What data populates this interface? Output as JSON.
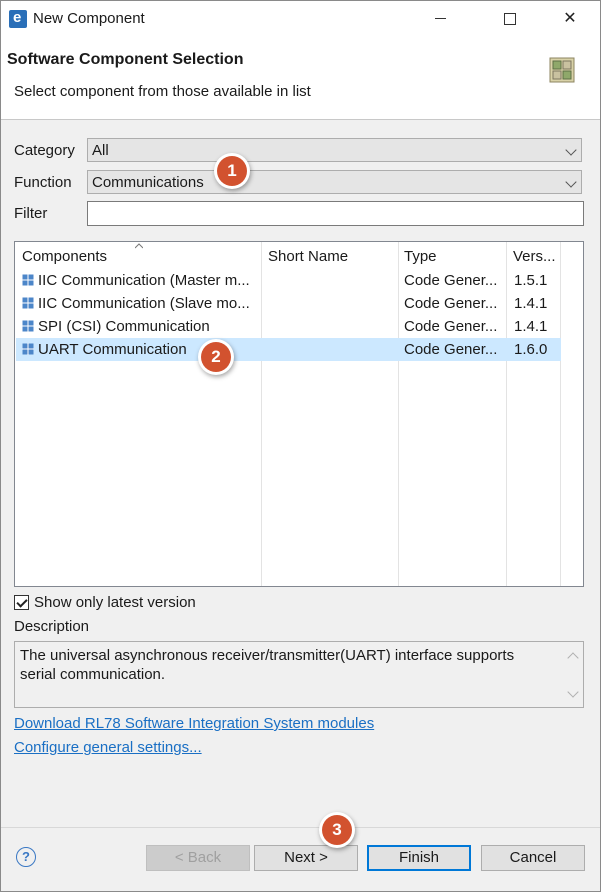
{
  "window": {
    "title": "New Component"
  },
  "header": {
    "title": "Software Component Selection",
    "subtitle": "Select component from those available in list"
  },
  "form": {
    "category_label": "Category",
    "category_value": "All",
    "function_label": "Function",
    "function_value": "Communications",
    "filter_label": "Filter",
    "filter_value": ""
  },
  "table": {
    "columns": [
      "Components",
      "Short Name",
      "Type",
      "Vers..."
    ],
    "rows": [
      {
        "component": "IIC Communication (Master m...",
        "short_name": "",
        "type": "Code Gener...",
        "version": "1.5.1",
        "selected": false
      },
      {
        "component": "IIC Communication (Slave mo...",
        "short_name": "",
        "type": "Code Gener...",
        "version": "1.4.1",
        "selected": false
      },
      {
        "component": "SPI (CSI) Communication",
        "short_name": "",
        "type": "Code Gener...",
        "version": "1.4.1",
        "selected": false
      },
      {
        "component": "UART Communication",
        "short_name": "",
        "type": "Code Gener...",
        "version": "1.6.0",
        "selected": true
      }
    ]
  },
  "options": {
    "latest_version_label": "Show only latest version",
    "latest_version_checked": true
  },
  "description": {
    "label": "Description",
    "text": "The universal asynchronous receiver/transmitter(UART) interface supports serial communication."
  },
  "links": {
    "download": "Download RL78 Software Integration System modules",
    "configure": "Configure general settings..."
  },
  "buttons": {
    "back": "< Back",
    "next": "Next >",
    "finish": "Finish",
    "cancel": "Cancel"
  },
  "markers": [
    "1",
    "2",
    "3"
  ],
  "colors": {
    "selection": "#cce8ff",
    "link": "#1a6fc4",
    "marker": "#d2522f"
  }
}
